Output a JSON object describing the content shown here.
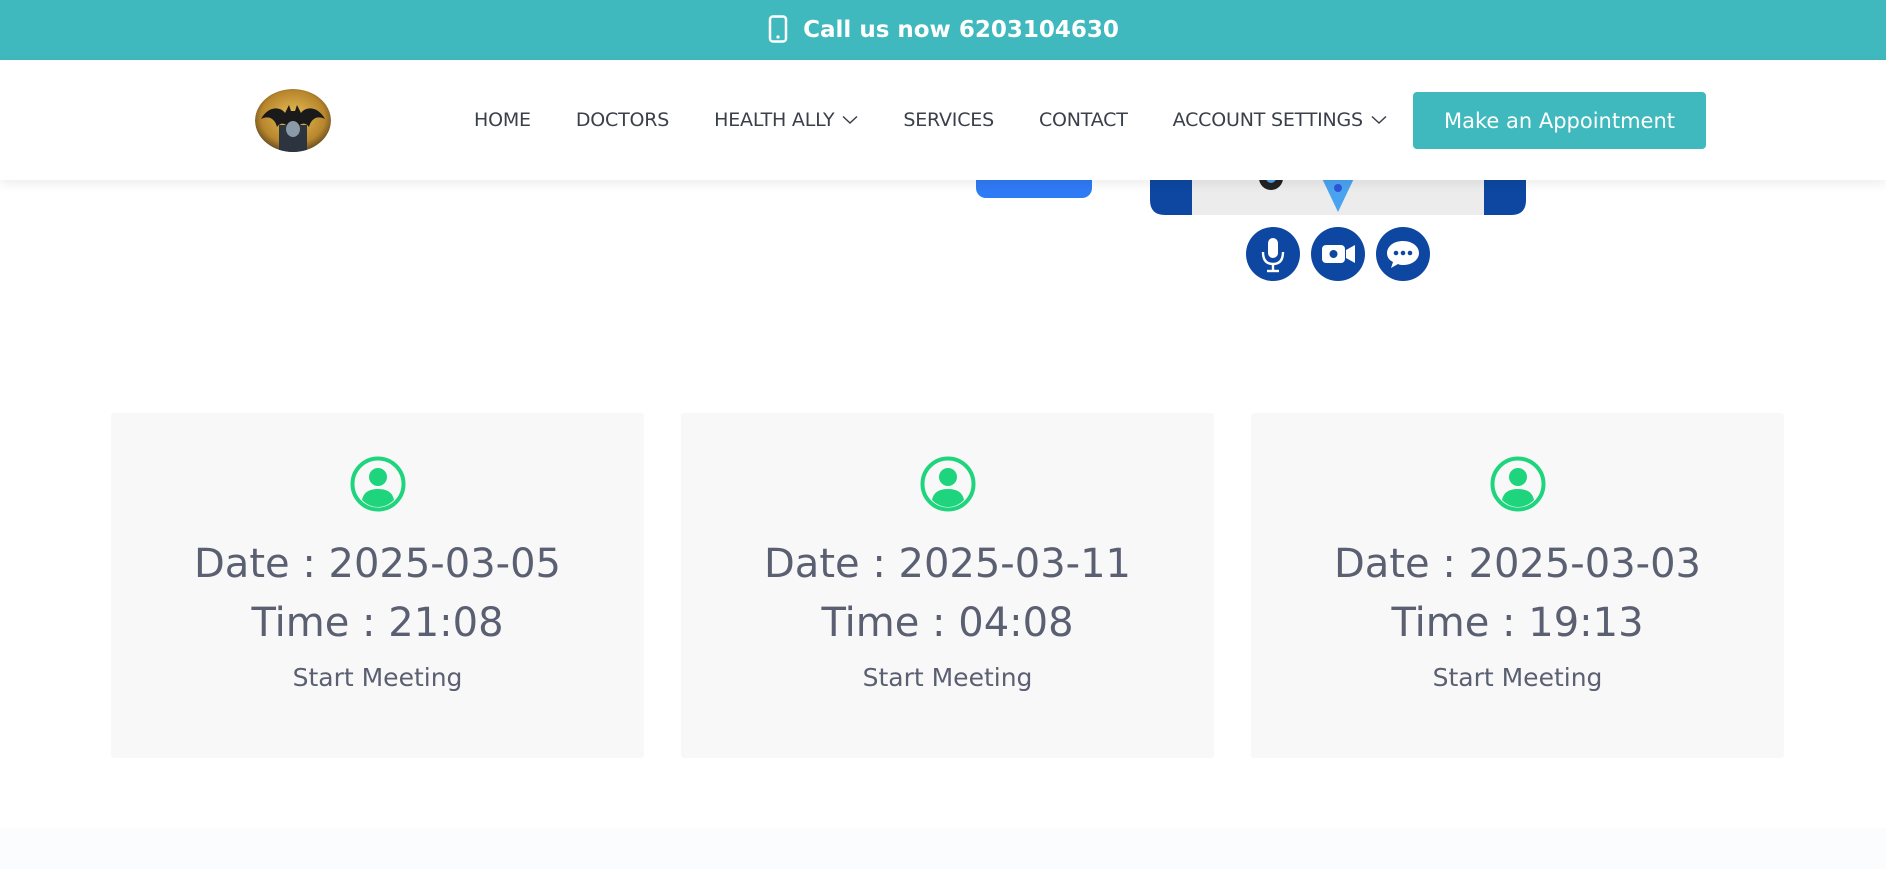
{
  "topbar": {
    "call_text": "Call us now 6203104630",
    "bg_color": "#3fb9be",
    "icon": "mobile-phone-icon"
  },
  "nav": {
    "logo_icon": "bat-logo-icon",
    "items": [
      {
        "label": "HOME",
        "dropdown": false
      },
      {
        "label": "DOCTORS",
        "dropdown": false
      },
      {
        "label": "HEALTH ALLY",
        "dropdown": true
      },
      {
        "label": "SERVICES",
        "dropdown": false
      },
      {
        "label": "CONTACT",
        "dropdown": false
      },
      {
        "label": "ACCOUNT SETTINGS",
        "dropdown": true
      }
    ],
    "cta_label": "Make an Appointment",
    "cta_color": "#3fb9be"
  },
  "hero": {
    "icons": [
      "microphone-icon",
      "video-camera-icon",
      "chat-bubble-icon"
    ],
    "accent_color": "#0d47a1"
  },
  "meetings": [
    {
      "date_label": "Date : 2025-03-05",
      "time_label": "Time : 21:08",
      "action": "Start Meeting"
    },
    {
      "date_label": "Date : 2025-03-11",
      "time_label": "Time : 04:08",
      "action": "Start Meeting"
    },
    {
      "date_label": "Date : 2025-03-03",
      "time_label": "Time : 19:13",
      "action": "Start Meeting"
    }
  ],
  "colors": {
    "user_icon": "#1ed57d",
    "card_text": "#5a6072",
    "card_bg": "#f8f8f8"
  }
}
